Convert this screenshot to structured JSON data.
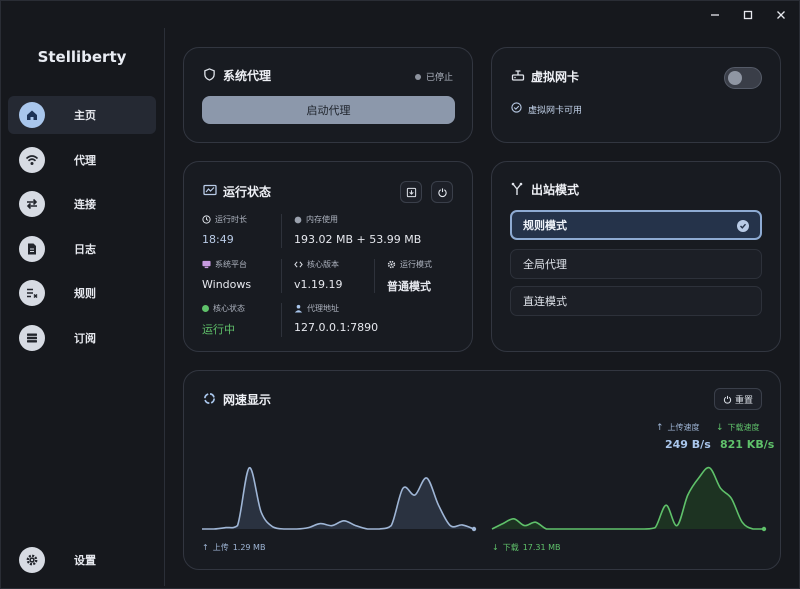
{
  "app_title": "Stelliberty",
  "window_controls": {
    "minimize": "minimize-icon",
    "maximize": "maximize-icon",
    "close": "close-icon"
  },
  "sidebar": {
    "items": [
      {
        "label": "主页",
        "icon": "home-icon",
        "active": true
      },
      {
        "label": "代理",
        "icon": "wifi-icon"
      },
      {
        "label": "连接",
        "icon": "swap-icon"
      },
      {
        "label": "日志",
        "icon": "document-icon"
      },
      {
        "label": "规则",
        "icon": "rules-icon"
      },
      {
        "label": "订阅",
        "icon": "list-icon"
      }
    ],
    "settings_label": "设置"
  },
  "system_proxy": {
    "title": "系统代理",
    "status": "已停止",
    "start_button": "启动代理"
  },
  "tun": {
    "title": "虚拟网卡",
    "status": "虚拟网卡可用",
    "enabled": false
  },
  "runtime": {
    "title": "运行状态",
    "uptime_label": "运行时长",
    "uptime": "18:49",
    "memory_label": "内存使用",
    "memory": "193.02 MB + 53.99 MB",
    "platform_label": "系统平台",
    "platform": "Windows",
    "core_version_label": "核心版本",
    "core_version": "v1.19.19",
    "run_mode_label": "运行模式",
    "run_mode": "普通模式",
    "core_status_label": "核心状态",
    "core_status": "运行中",
    "proxy_addr_label": "代理地址",
    "proxy_addr": "127.0.0.1:7890"
  },
  "outbound": {
    "title": "出站模式",
    "options": [
      {
        "label": "规则模式",
        "selected": true
      },
      {
        "label": "全局代理",
        "selected": false
      },
      {
        "label": "直连模式",
        "selected": false
      }
    ]
  },
  "speed": {
    "title": "网速显示",
    "reset_label": "重置",
    "upload_speed_label": "上传速度",
    "upload_speed": "249 B/s",
    "download_speed_label": "下载速度",
    "download_speed": "821 KB/s",
    "upload_total_label": "上传",
    "upload_total": "1.29 MB",
    "download_total_label": "下载",
    "download_total": "17.31 MB"
  },
  "colors": {
    "accent": "#a9c6ec",
    "upload": "#9fb6d6",
    "download": "#5fc16a",
    "running": "#5fc16a"
  },
  "chart_data": [
    {
      "type": "area",
      "series": [
        {
          "name": "上传",
          "values": [
            0.0,
            0.0,
            0.02,
            0.05,
            0.9,
            0.25,
            0.03,
            0.0,
            0.0,
            0.02,
            0.08,
            0.05,
            0.12,
            0.05,
            0.0,
            0.0,
            0.05,
            0.6,
            0.5,
            0.75,
            0.35,
            0.05,
            0.06,
            0.0
          ]
        }
      ]
    },
    {
      "type": "area",
      "series": [
        {
          "name": "下载",
          "values": [
            0.0,
            0.08,
            0.15,
            0.05,
            0.1,
            0.0,
            0.0,
            0.0,
            0.0,
            0.0,
            0.0,
            0.0,
            0.0,
            0.0,
            0.0,
            0.02,
            0.35,
            0.05,
            0.5,
            0.75,
            0.9,
            0.6,
            0.45,
            0.1,
            0.0,
            0.0
          ]
        }
      ]
    }
  ]
}
